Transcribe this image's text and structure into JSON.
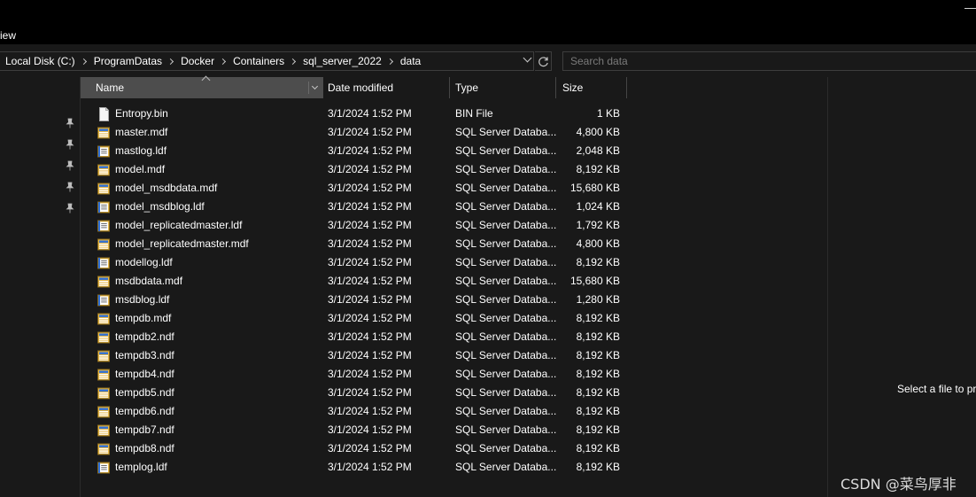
{
  "menubar": {
    "partial_label": "iew"
  },
  "address": {
    "crumbs": [
      "Local Disk (C:)",
      "ProgramDatas",
      "Docker",
      "Containers",
      "sql_server_2022",
      "data"
    ]
  },
  "search": {
    "placeholder": "Search data"
  },
  "columns": {
    "name": "Name",
    "date": "Date modified",
    "type": "Type",
    "size": "Size"
  },
  "files": [
    {
      "name": "Entropy.bin",
      "date": "3/1/2024 1:52 PM",
      "type": "BIN File",
      "size": "1 KB",
      "icon": "blank-file-icon"
    },
    {
      "name": "master.mdf",
      "date": "3/1/2024 1:52 PM",
      "type": "SQL Server Databa...",
      "size": "4,800 KB",
      "icon": "sql-database-file-icon"
    },
    {
      "name": "mastlog.ldf",
      "date": "3/1/2024 1:52 PM",
      "type": "SQL Server Databa...",
      "size": "2,048 KB",
      "icon": "sql-log-file-icon"
    },
    {
      "name": "model.mdf",
      "date": "3/1/2024 1:52 PM",
      "type": "SQL Server Databa...",
      "size": "8,192 KB",
      "icon": "sql-database-file-icon"
    },
    {
      "name": "model_msdbdata.mdf",
      "date": "3/1/2024 1:52 PM",
      "type": "SQL Server Databa...",
      "size": "15,680 KB",
      "icon": "sql-database-file-icon"
    },
    {
      "name": "model_msdblog.ldf",
      "date": "3/1/2024 1:52 PM",
      "type": "SQL Server Databa...",
      "size": "1,024 KB",
      "icon": "sql-log-file-icon"
    },
    {
      "name": "model_replicatedmaster.ldf",
      "date": "3/1/2024 1:52 PM",
      "type": "SQL Server Databa...",
      "size": "1,792 KB",
      "icon": "sql-log-file-icon"
    },
    {
      "name": "model_replicatedmaster.mdf",
      "date": "3/1/2024 1:52 PM",
      "type": "SQL Server Databa...",
      "size": "4,800 KB",
      "icon": "sql-database-file-icon"
    },
    {
      "name": "modellog.ldf",
      "date": "3/1/2024 1:52 PM",
      "type": "SQL Server Databa...",
      "size": "8,192 KB",
      "icon": "sql-log-file-icon"
    },
    {
      "name": "msdbdata.mdf",
      "date": "3/1/2024 1:52 PM",
      "type": "SQL Server Databa...",
      "size": "15,680 KB",
      "icon": "sql-database-file-icon"
    },
    {
      "name": "msdblog.ldf",
      "date": "3/1/2024 1:52 PM",
      "type": "SQL Server Databa...",
      "size": "1,280 KB",
      "icon": "sql-log-file-icon"
    },
    {
      "name": "tempdb.mdf",
      "date": "3/1/2024 1:52 PM",
      "type": "SQL Server Databa...",
      "size": "8,192 KB",
      "icon": "sql-database-file-icon"
    },
    {
      "name": "tempdb2.ndf",
      "date": "3/1/2024 1:52 PM",
      "type": "SQL Server Databa...",
      "size": "8,192 KB",
      "icon": "sql-database-file-icon"
    },
    {
      "name": "tempdb3.ndf",
      "date": "3/1/2024 1:52 PM",
      "type": "SQL Server Databa...",
      "size": "8,192 KB",
      "icon": "sql-database-file-icon"
    },
    {
      "name": "tempdb4.ndf",
      "date": "3/1/2024 1:52 PM",
      "type": "SQL Server Databa...",
      "size": "8,192 KB",
      "icon": "sql-database-file-icon"
    },
    {
      "name": "tempdb5.ndf",
      "date": "3/1/2024 1:52 PM",
      "type": "SQL Server Databa...",
      "size": "8,192 KB",
      "icon": "sql-database-file-icon"
    },
    {
      "name": "tempdb6.ndf",
      "date": "3/1/2024 1:52 PM",
      "type": "SQL Server Databa...",
      "size": "8,192 KB",
      "icon": "sql-database-file-icon"
    },
    {
      "name": "tempdb7.ndf",
      "date": "3/1/2024 1:52 PM",
      "type": "SQL Server Databa...",
      "size": "8,192 KB",
      "icon": "sql-database-file-icon"
    },
    {
      "name": "tempdb8.ndf",
      "date": "3/1/2024 1:52 PM",
      "type": "SQL Server Databa...",
      "size": "8,192 KB",
      "icon": "sql-database-file-icon"
    },
    {
      "name": "templog.ldf",
      "date": "3/1/2024 1:52 PM",
      "type": "SQL Server Databa...",
      "size": "8,192 KB",
      "icon": "sql-log-file-icon"
    }
  ],
  "preview": {
    "message": "Select a file to pr"
  },
  "watermark": "CSDN @菜鸟厚非",
  "colors": {
    "background": "#191919",
    "titlebar": "#000000",
    "header_sorted": "#4d4d4d",
    "icon_folder": "#e6b84a",
    "icon_db": "#2f6fd6"
  }
}
